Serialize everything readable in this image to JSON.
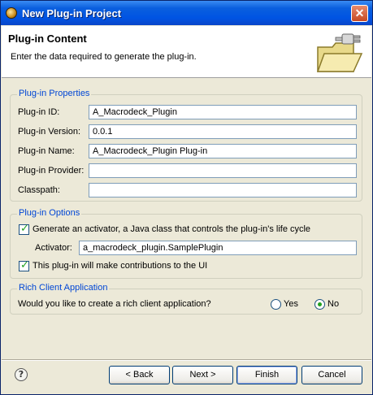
{
  "window": {
    "title": "New Plug-in Project",
    "close_glyph": "✕"
  },
  "header": {
    "title": "Plug-in Content",
    "description": "Enter the data required to generate the plug-in."
  },
  "properties": {
    "group_label": "Plug-in Properties",
    "fields": [
      {
        "label": "Plug-in ID:",
        "value": "A_Macrodeck_Plugin"
      },
      {
        "label": "Plug-in Version:",
        "value": "0.0.1"
      },
      {
        "label": "Plug-in Name:",
        "value": "A_Macrodeck_Plugin Plug-in"
      },
      {
        "label": "Plug-in Provider:",
        "value": ""
      },
      {
        "label": "Classpath:",
        "value": ""
      }
    ]
  },
  "options": {
    "group_label": "Plug-in Options",
    "generate_activator_label": "Generate an activator, a Java class that controls the plug-in's life cycle",
    "generate_activator_checked": true,
    "activator_label": "Activator:",
    "activator_value": "a_macrodeck_plugin.SamplePlugin",
    "ui_contrib_label": "This plug-in will make contributions to the UI",
    "ui_contrib_checked": true
  },
  "rich_client": {
    "group_label": "Rich Client Application",
    "question": "Would you like to create a rich client application?",
    "yes_label": "Yes",
    "no_label": "No",
    "selected": "No"
  },
  "buttons": {
    "back": "< Back",
    "next": "Next >",
    "finish": "Finish",
    "cancel": "Cancel",
    "help_glyph": "?"
  },
  "icons": {
    "title": "eclipse-icon",
    "header": "plugin-folder-icon",
    "help": "help-icon"
  }
}
